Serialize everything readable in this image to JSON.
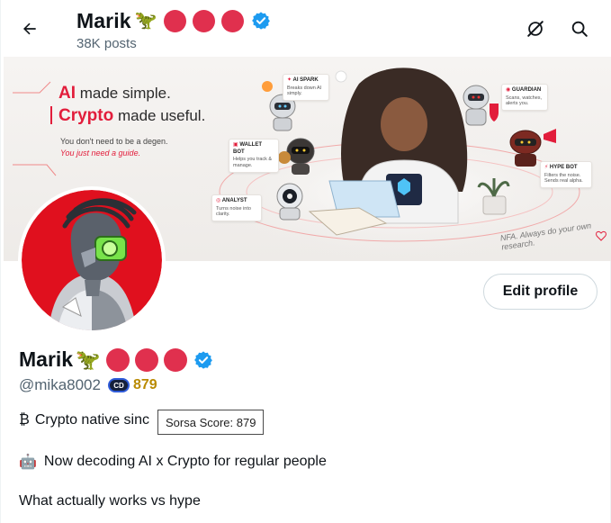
{
  "header": {
    "name": "Marik",
    "dino_emoji": "🦖",
    "posts": "38K posts",
    "icons": [
      "back-arrow-icon",
      "no-signal-icon",
      "search-icon"
    ]
  },
  "banner": {
    "line1_accent": "AI",
    "line1_rest": "made simple.",
    "line2_accent": "Crypto",
    "line2_rest": "made useful.",
    "line3": "You don't need to be a degen.",
    "line4": "You just need a guide.",
    "cards": {
      "ai_spark": {
        "title": "AI SPARK",
        "body": "Breaks down AI simply."
      },
      "guardian": {
        "title": "GUARDIAN",
        "body": "Scans, watches, alerts you."
      },
      "wallet_bot": {
        "title": "WALLET BOT",
        "body": "Helps you track & manage."
      },
      "hype_bot": {
        "title": "HYPE BOT",
        "body": "Filters the noise. Sends real alpha."
      },
      "analyst": {
        "title": "ANALYST",
        "body": "Turns noise into clarity."
      }
    },
    "nfa_note": "NFA. Always do your own research."
  },
  "profile": {
    "name": "Marik",
    "dino_emoji": "🦖",
    "handle": "@mika8002",
    "score_icon_text": "CD",
    "score": "879",
    "edit_button": "Edit profile"
  },
  "tooltip": "Sorsa Score: 879",
  "bio": {
    "line1_symbol": "₿",
    "line1_text": "Crypto native sinc",
    "line2_emoji": "🤖",
    "line2_text": "Now decoding AI x Crypto for regular people",
    "line3_text": "What actually works vs hype"
  },
  "colors": {
    "accent_red": "#e0304e",
    "verified_blue": "#1d9bf0",
    "score_gold": "#b98a00",
    "muted_text": "#536471"
  }
}
